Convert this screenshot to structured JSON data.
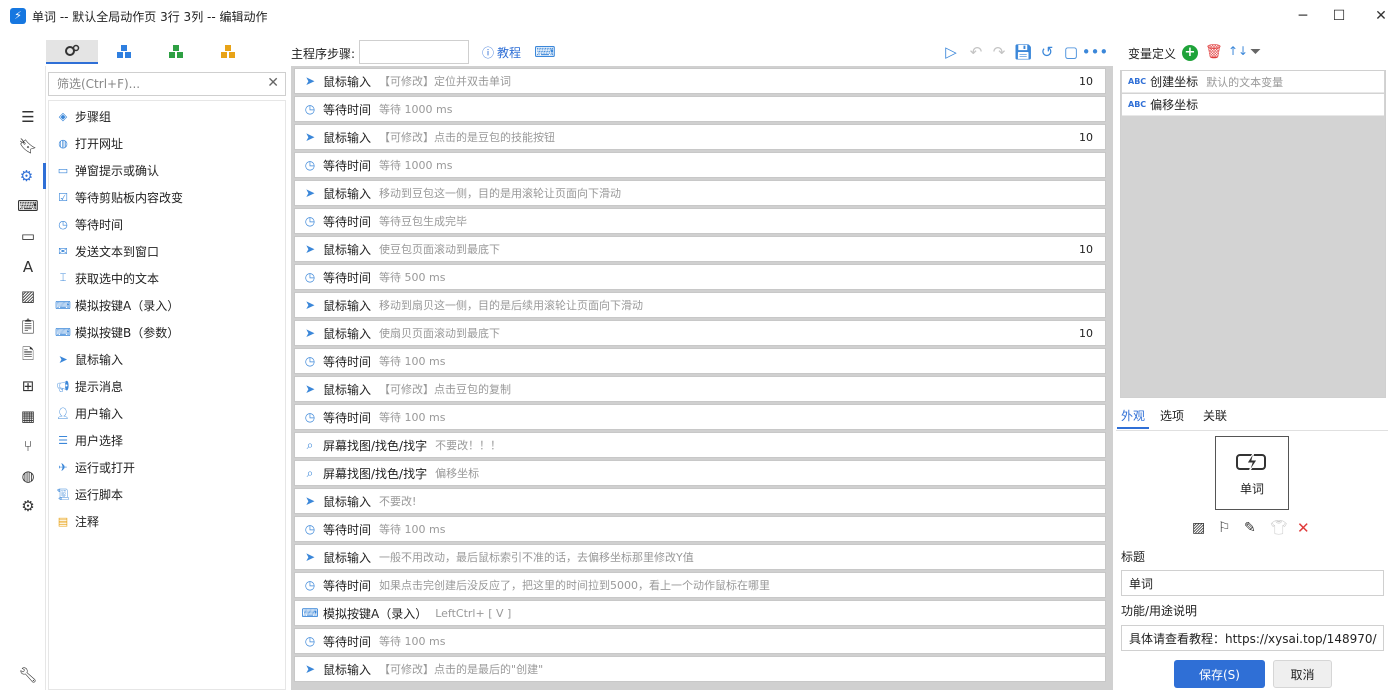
{
  "window": {
    "title": "单词 -- 默认全局动作页 3行 3列 -- 编辑动作",
    "app_icon": "app-logo-icon",
    "controls": [
      "minimize",
      "maximize",
      "close"
    ]
  },
  "tool_tabs": [
    {
      "icon": "gears-icon",
      "active": true
    },
    {
      "icon": "cubes-blue-icon"
    },
    {
      "icon": "cubes-green-icon"
    },
    {
      "icon": "cubes-orange-icon"
    }
  ],
  "nav_icons": [
    "menu-icon",
    "bookmark-icon",
    "settings-icon",
    "keyboard-icon",
    "window-icon",
    "text-icon",
    "image-icon",
    "clipboard-icon",
    "document-icon",
    "windows-icon",
    "grid-icon",
    "branch-icon",
    "globe-icon",
    "gear-alt-icon",
    "wrench-icon"
  ],
  "filter": {
    "placeholder": "筛选(Ctrl+F)...",
    "value": ""
  },
  "actions": [
    {
      "label": "步骤组",
      "icon": "layers-icon"
    },
    {
      "label": "打开网址",
      "icon": "globe-icon"
    },
    {
      "label": "弹窗提示或确认",
      "icon": "dialog-icon"
    },
    {
      "label": "等待剪贴板内容改变",
      "icon": "clipboard-check-icon"
    },
    {
      "label": "等待时间",
      "icon": "timer-icon"
    },
    {
      "label": "发送文本到窗口",
      "icon": "message-icon"
    },
    {
      "label": "获取选中的文本",
      "icon": "text-cursor-icon"
    },
    {
      "label": "模拟按键A（录入）",
      "icon": "keyboard-icon"
    },
    {
      "label": "模拟按键B（参数）",
      "icon": "keyboard-icon"
    },
    {
      "label": "鼠标输入",
      "icon": "cursor-icon"
    },
    {
      "label": "提示消息",
      "icon": "megaphone-icon"
    },
    {
      "label": "用户输入",
      "icon": "user-edit-icon"
    },
    {
      "label": "用户选择",
      "icon": "list-icon"
    },
    {
      "label": "运行或打开",
      "icon": "send-icon"
    },
    {
      "label": "运行脚本",
      "icon": "script-icon"
    },
    {
      "label": "注释",
      "icon": "note-icon"
    }
  ],
  "main": {
    "steps_label": "主程序步骤:",
    "steps_input": "",
    "tutorial": "教程"
  },
  "steps": [
    {
      "name": "鼠标输入",
      "desc": "【可修改】定位并双击单词",
      "num": "10",
      "icon": "cursor-icon"
    },
    {
      "name": "等待时间",
      "desc": "等待 1000 ms",
      "num": "",
      "icon": "timer-icon"
    },
    {
      "name": "鼠标输入",
      "desc": "【可修改】点击的是豆包的技能按钮",
      "num": "10",
      "icon": "cursor-icon"
    },
    {
      "name": "等待时间",
      "desc": "等待 1000 ms",
      "num": "",
      "icon": "timer-icon"
    },
    {
      "name": "鼠标输入",
      "desc": "移动到豆包这一侧，目的是用滚轮让页面向下滑动",
      "num": "",
      "icon": "cursor-icon"
    },
    {
      "name": "等待时间",
      "desc": "等待豆包生成完毕",
      "num": "",
      "icon": "timer-icon"
    },
    {
      "name": "鼠标输入",
      "desc": "使豆包页面滚动到最底下",
      "num": "10",
      "icon": "cursor-icon"
    },
    {
      "name": "等待时间",
      "desc": "等待 500 ms",
      "num": "",
      "icon": "timer-icon"
    },
    {
      "name": "鼠标输入",
      "desc": "移动到扇贝这一侧，目的是后续用滚轮让页面向下滑动",
      "num": "",
      "icon": "cursor-icon"
    },
    {
      "name": "鼠标输入",
      "desc": "使扇贝页面滚动到最底下",
      "num": "10",
      "icon": "cursor-icon"
    },
    {
      "name": "等待时间",
      "desc": "等待 100 ms",
      "num": "",
      "icon": "timer-icon"
    },
    {
      "name": "鼠标输入",
      "desc": "【可修改】点击豆包的复制",
      "num": "",
      "icon": "cursor-icon"
    },
    {
      "name": "等待时间",
      "desc": "等待 100 ms",
      "num": "",
      "icon": "timer-icon"
    },
    {
      "name": "屏幕找图/找色/找字",
      "desc": "不要改！！！",
      "num": "",
      "icon": "search-image-icon"
    },
    {
      "name": "屏幕找图/找色/找字",
      "desc": "偏移坐标",
      "num": "",
      "icon": "search-image-icon"
    },
    {
      "name": "鼠标输入",
      "desc": "不要改!",
      "num": "",
      "icon": "cursor-icon"
    },
    {
      "name": "等待时间",
      "desc": "等待 100 ms",
      "num": "",
      "icon": "timer-icon"
    },
    {
      "name": "鼠标输入",
      "desc": "一般不用改动，最后鼠标索引不准的话，去偏移坐标那里修改Y值",
      "num": "",
      "icon": "cursor-icon"
    },
    {
      "name": "等待时间",
      "desc": "如果点击完创建后没反应了，把这里的时间拉到5000，看上一个动作鼠标在哪里",
      "num": "",
      "icon": "timer-icon"
    },
    {
      "name": "模拟按键A（录入）",
      "desc": "LeftCtrl+ [ V ]",
      "num": "",
      "icon": "keyboard-icon"
    },
    {
      "name": "等待时间",
      "desc": "等待 100 ms",
      "num": "",
      "icon": "timer-icon"
    },
    {
      "name": "鼠标输入",
      "desc": "【可修改】点击的是最后的\"创建\"",
      "num": "",
      "icon": "cursor-icon"
    }
  ],
  "variables": {
    "header": "变量定义",
    "items": [
      {
        "name": "创建坐标",
        "desc": "默认的文本变量",
        "type": "ABC"
      },
      {
        "name": "偏移坐标",
        "desc": "",
        "type": "ABC"
      }
    ]
  },
  "right_tabs": [
    {
      "label": "外观",
      "active": true
    },
    {
      "label": "选项"
    },
    {
      "label": "关联"
    }
  ],
  "appearance": {
    "preview_label": "单词",
    "preview_icon": "lightning-icon",
    "title_label": "标题",
    "title_value": "单词",
    "desc_label": "功能/用途说明",
    "desc_value": "具体请查看教程：https://xysai.top/148970/"
  },
  "buttons": {
    "save": "保存(S)",
    "cancel": "取消"
  },
  "colors": {
    "accent": "#2f6fd6",
    "icon_blue": "#3b87d9",
    "add_green": "#1fa33a",
    "delete_red": "#e03b3b"
  }
}
